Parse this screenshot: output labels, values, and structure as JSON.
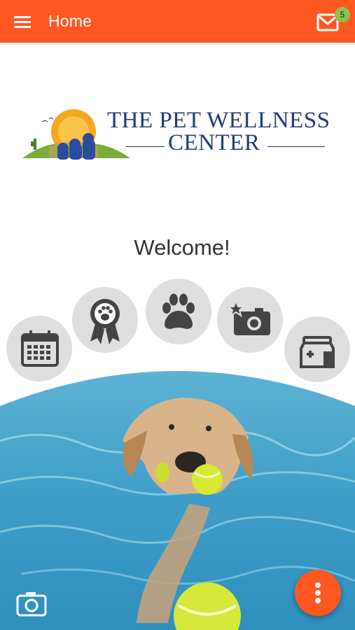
{
  "header": {
    "title": "Home",
    "menu_icon": "hamburger-menu-icon",
    "mail_icon": "mail-icon",
    "unread_count": "5"
  },
  "logo": {
    "line1": "THE PET WELLNESS",
    "line2": "CENTER"
  },
  "welcome_text": "Welcome!",
  "quick_actions": [
    {
      "icon": "calendar-icon"
    },
    {
      "icon": "award-ribbon-paw-icon"
    },
    {
      "icon": "paw-icon"
    },
    {
      "icon": "photo-camera-star-icon"
    },
    {
      "icon": "pharmacy-bag-icon"
    }
  ],
  "bottom": {
    "camera_icon": "camera-icon",
    "more_icon": "more-vertical-icon"
  },
  "colors": {
    "accent": "#ff5722",
    "badge": "#8bc34a",
    "logo_navy": "#243a7a",
    "action_circle": "#dedede",
    "icon_dark": "#444444"
  }
}
